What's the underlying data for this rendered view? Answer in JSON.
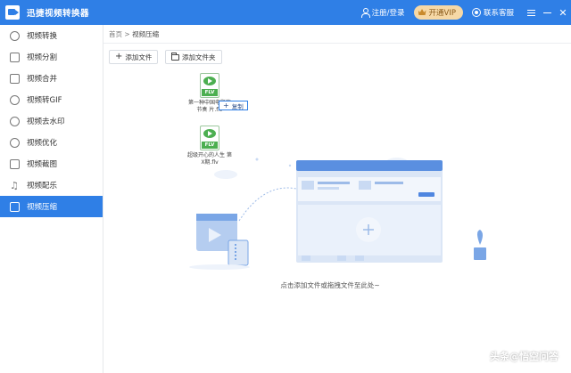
{
  "app": {
    "title": "迅捷视频转换器"
  },
  "titlebar": {
    "login": "注册/登录",
    "vip": "开通VIP",
    "service": "联系客服"
  },
  "sidebar": {
    "items": [
      {
        "label": "视频转换",
        "icon": "convert-icon"
      },
      {
        "label": "视频分割",
        "icon": "split-icon"
      },
      {
        "label": "视频合并",
        "icon": "merge-icon"
      },
      {
        "label": "视频转GIF",
        "icon": "gif-icon"
      },
      {
        "label": "视频去水印",
        "icon": "watermark-icon"
      },
      {
        "label": "视频优化",
        "icon": "optimize-icon"
      },
      {
        "label": "视频截图",
        "icon": "screenshot-icon"
      },
      {
        "label": "视频配乐",
        "icon": "music-icon"
      },
      {
        "label": "视频压缩",
        "icon": "compress-icon",
        "active": true
      }
    ]
  },
  "breadcrumb": {
    "home": "首页",
    "sep": ">",
    "current": "视频压缩"
  },
  "toolbar": {
    "add_file": "添加文件",
    "add_folder": "添加文件夹"
  },
  "dragged_files": {
    "badge": "FLV",
    "file1_name": "第一种中国电影的节奏 片.flv",
    "file2_name": "超级开心的人生 第X期.flv",
    "copy_tip": "复制"
  },
  "main": {
    "drop_hint": "点击添加文件或拖拽文件至此处~"
  },
  "watermark": {
    "text": "头条@悟空问答"
  },
  "colors": {
    "accent": "#2f7fe6",
    "vip_bg": "#f6d8a6",
    "file_green": "#4caf50"
  }
}
